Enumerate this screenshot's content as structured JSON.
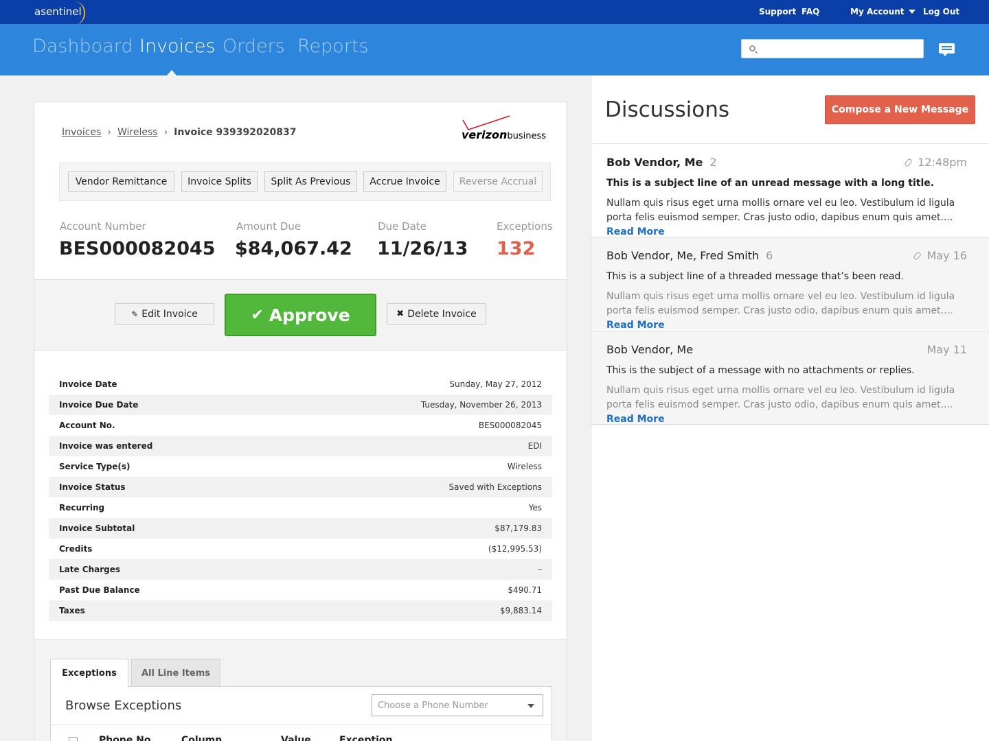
{
  "topbar": {
    "brand": "asentinel",
    "links": {
      "support": "Support",
      "faq": "FAQ",
      "my_account": "My Account",
      "log_out": "Log Out"
    }
  },
  "nav": {
    "tabs": [
      "Dashboard",
      "Invoices",
      "Orders",
      "Reports"
    ],
    "active": "Invoices",
    "search_placeholder": ""
  },
  "breadcrumb": {
    "level1": "Invoices",
    "level2": "Wireless",
    "current": "Invoice 939392020837"
  },
  "vendor_logo": {
    "word": "verizon",
    "suffix": "business"
  },
  "actions": [
    "Vendor Remittance",
    "Invoice Splits",
    "Split As Previous",
    "Accrue Invoice",
    "Reverse Accrual"
  ],
  "stats": [
    {
      "label": "Account Number",
      "value": "BES000082045"
    },
    {
      "label": "Amount Due",
      "value": "$84,067.42"
    },
    {
      "label": "Due Date",
      "value": "11/26/13"
    },
    {
      "label": "Exceptions",
      "value": "132"
    }
  ],
  "buttons": {
    "edit": "Edit Invoice",
    "approve": "Approve",
    "delete": "Delete Invoice"
  },
  "details": [
    {
      "key": "Invoice Date",
      "value": "Sunday, May 27, 2012"
    },
    {
      "key": "Invoice Due Date",
      "value": "Tuesday, November 26, 2013"
    },
    {
      "key": "Account No.",
      "value": "BES000082045"
    },
    {
      "key": "Invoice was entered",
      "value": "EDI"
    },
    {
      "key": "Service Type(s)",
      "value": "Wireless"
    },
    {
      "key": "Invoice Status",
      "value": "Saved with Exceptions"
    },
    {
      "key": "Recurring",
      "value": "Yes"
    },
    {
      "key": "Invoice Subtotal",
      "value": "$87,179.83"
    },
    {
      "key": "Credits",
      "value": "($12,995.53)"
    },
    {
      "key": "Late Charges",
      "value": "–"
    },
    {
      "key": "Past Due Balance",
      "value": "$490.71"
    },
    {
      "key": "Taxes",
      "value": "$9,883.14"
    }
  ],
  "tabs": {
    "exceptions": "Exceptions",
    "all_line_items": "All Line Items"
  },
  "exceptions_panel": {
    "title": "Browse Exceptions",
    "select_placeholder": "Choose a Phone Number",
    "columns": [
      "Phone No.",
      "Column",
      "Value",
      "Exception"
    ]
  },
  "discussions": {
    "title": "Discussions",
    "compose_label": "Compose a New Message",
    "messages": [
      {
        "from": "Bob Vendor, Me",
        "count": "2",
        "time": "12:48pm",
        "subject": "This is a subject line of an unread message with a long title.",
        "body": "Nullam quis risus eget urna mollis ornare vel eu leo. Vestibulum id ligula porta felis euismod semper. Cras justo odio, dapibus enum quis amet....",
        "read_more": "Read More"
      },
      {
        "from": "Bob Vendor, Me, Fred Smith",
        "count": "6",
        "time": "May 16",
        "subject": "This is a subject line of a threaded message that’s been read.",
        "body": "Nullam quis risus eget urna mollis ornare vel eu leo. Vestibulum id ligula porta felis euismod semper. Cras justo odio, dapibus enum quis amet....",
        "read_more": "Read More"
      },
      {
        "from": "Bob Vendor, Me",
        "count": "",
        "time": "May 11",
        "subject": "This is the subject of a message with no attachments or replies.",
        "body": "Nullam quis risus eget urna mollis ornare vel eu leo. Vestibulum id ligula porta felis euismod semper. Cras justo odio, dapibus enum quis amet....",
        "read_more": "Read More"
      }
    ]
  },
  "colors": {
    "topbar": "#0a3fa8",
    "navbar": "#2d86db",
    "approve": "#52b83b",
    "compose": "#e2614b",
    "exceptions_value": "#e0604c",
    "link": "#1d6fc7"
  }
}
